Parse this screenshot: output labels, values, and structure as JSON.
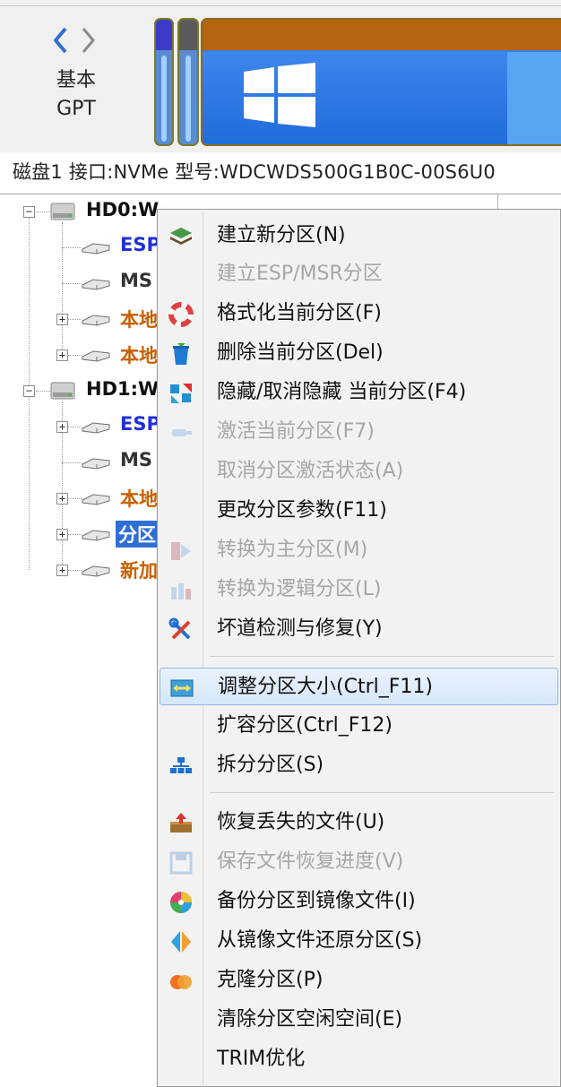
{
  "disk_bar": {
    "disk_line1": "基本",
    "disk_line2": "GPT",
    "disk_info": "磁盘1 接口:NVMe  型号:WDCWDS500G1B0C-00S6U0"
  },
  "tree": {
    "disks": [
      {
        "label": "HD0:W",
        "partitions": [
          {
            "label": "ESP",
            "color": "#2030d8",
            "expander": ""
          },
          {
            "label": "MS",
            "color": "#333333",
            "expander": ""
          },
          {
            "label": "本地",
            "color": "#c86000",
            "expander": "+"
          },
          {
            "label": "本地",
            "color": "#c86000",
            "expander": "+"
          }
        ]
      },
      {
        "label": "HD1:W",
        "partitions": [
          {
            "label": "ESP",
            "color": "#2030d8",
            "expander": "+"
          },
          {
            "label": "MS",
            "color": "#333333",
            "expander": ""
          },
          {
            "label": "本地",
            "color": "#c86000",
            "expander": "+"
          },
          {
            "label": "分区",
            "color": "#ffffff",
            "expander": "+",
            "selected": true
          },
          {
            "label": "新加",
            "color": "#c86000",
            "expander": "+"
          }
        ]
      }
    ]
  },
  "context_menu": {
    "items": [
      {
        "label": "建立新分区(N)",
        "icon": "layers-icon",
        "enabled": true
      },
      {
        "label": "建立ESP/MSR分区",
        "icon": "none",
        "enabled": false
      },
      {
        "label": "格式化当前分区(F)",
        "icon": "lifebuoy-icon",
        "enabled": true
      },
      {
        "label": "删除当前分区(Del)",
        "icon": "trash-icon",
        "enabled": true
      },
      {
        "label": "隐藏/取消隐藏 当前分区(F4)",
        "icon": "hide-icon",
        "enabled": true
      },
      {
        "label": "激活当前分区(F7)",
        "icon": "activate-icon",
        "enabled": false
      },
      {
        "label": "取消分区激活状态(A)",
        "icon": "none",
        "enabled": false
      },
      {
        "label": "更改分区参数(F11)",
        "icon": "none",
        "enabled": true
      },
      {
        "label": "转换为主分区(M)",
        "icon": "convert-primary-icon",
        "enabled": false
      },
      {
        "label": "转换为逻辑分区(L)",
        "icon": "convert-logical-icon",
        "enabled": false
      },
      {
        "label": "坏道检测与修复(Y)",
        "icon": "tools-icon",
        "enabled": true
      },
      {
        "label": "调整分区大小(Ctrl_F11)",
        "icon": "resize-icon",
        "enabled": true,
        "highlighted": true
      },
      {
        "label": "扩容分区(Ctrl_F12)",
        "icon": "none",
        "enabled": true
      },
      {
        "label": "拆分分区(S)",
        "icon": "split-icon",
        "enabled": true
      },
      {
        "label": "恢复丢失的文件(U)",
        "icon": "recover-icon",
        "enabled": true
      },
      {
        "label": "保存文件恢复进度(V)",
        "icon": "save-icon",
        "enabled": false
      },
      {
        "label": "备份分区到镜像文件(I)",
        "icon": "backup-icon",
        "enabled": true
      },
      {
        "label": "从镜像文件还原分区(S)",
        "icon": "restore-icon",
        "enabled": true
      },
      {
        "label": "克隆分区(P)",
        "icon": "clone-icon",
        "enabled": true
      },
      {
        "label": "清除分区空闲空间(E)",
        "icon": "none",
        "enabled": true
      },
      {
        "label": "TRIM优化",
        "icon": "none",
        "enabled": true
      }
    ]
  }
}
